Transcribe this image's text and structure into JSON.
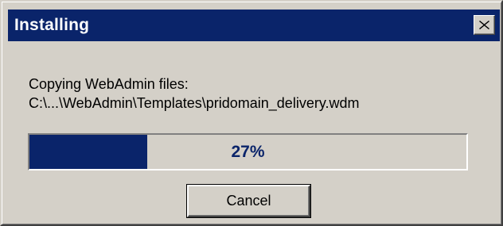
{
  "window": {
    "title": "Installing",
    "close_label": "close"
  },
  "message": {
    "line1": "Copying WebAdmin files:",
    "line2": "C:\\...\\WebAdmin\\Templates\\pridomain_delivery.wdm"
  },
  "progress": {
    "percent": 27,
    "label": "27%"
  },
  "buttons": {
    "cancel_label": "Cancel"
  },
  "colors": {
    "titlebar": "#0a246a",
    "progress_fill": "#0a246a",
    "dialog_face": "#d4d0c8"
  },
  "icons": {
    "close": "close-icon"
  }
}
